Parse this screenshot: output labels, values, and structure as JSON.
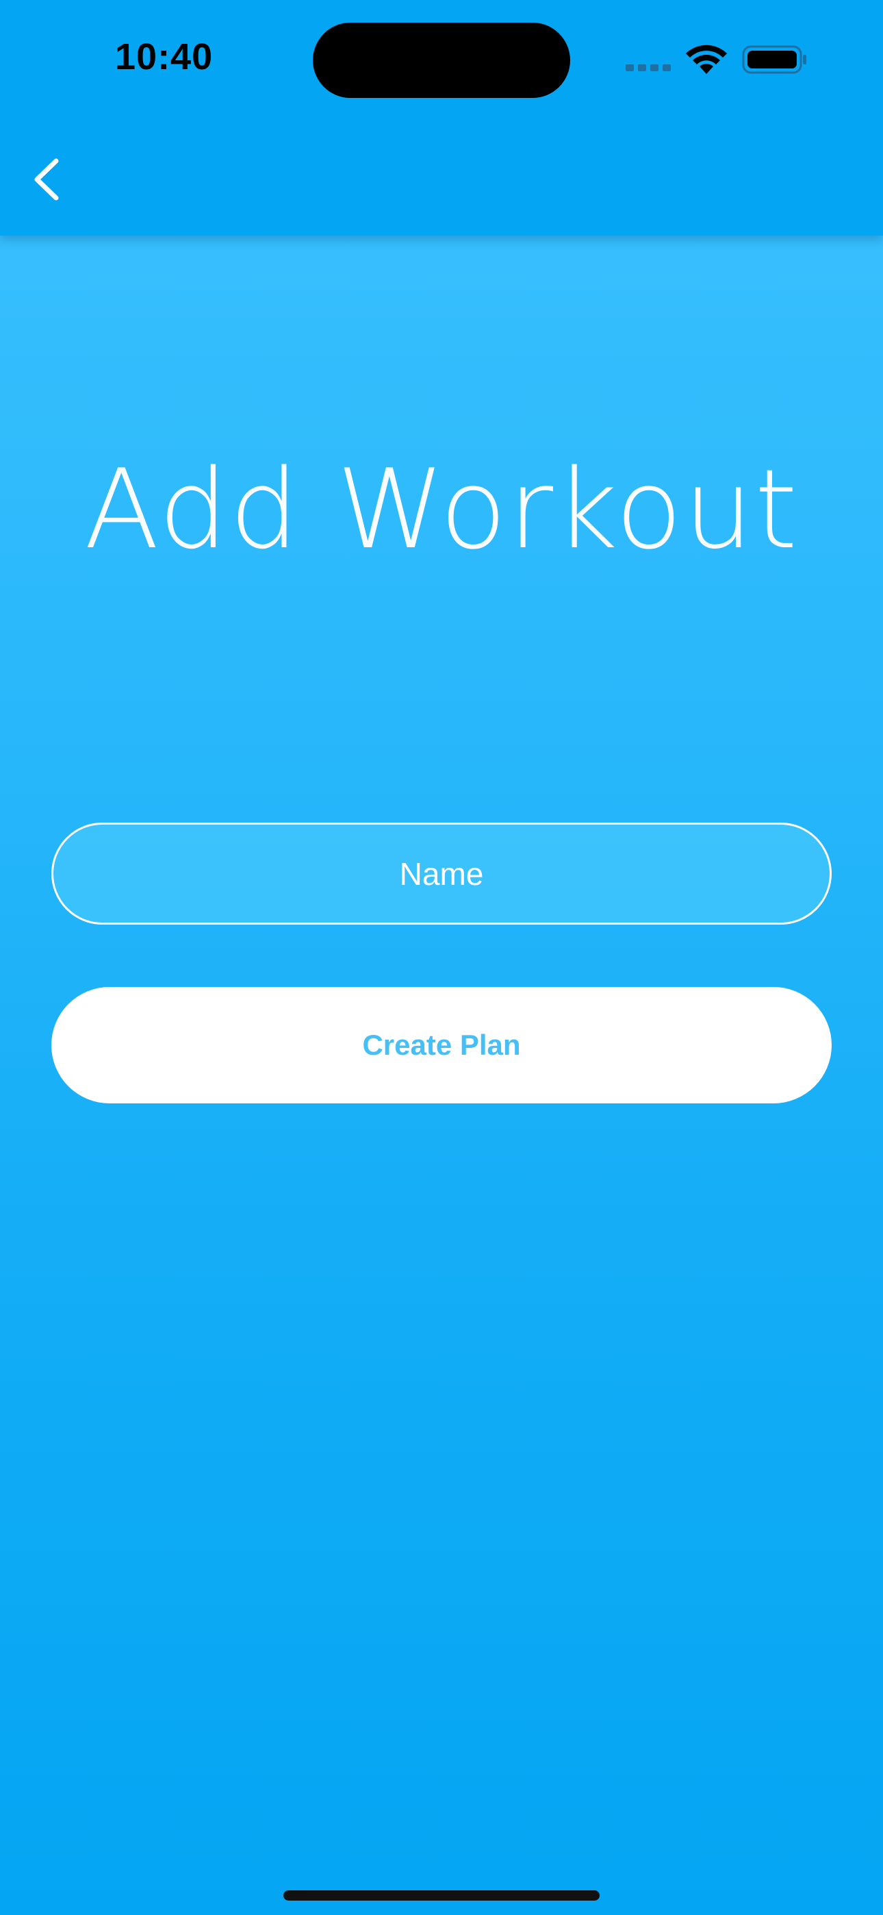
{
  "status_bar": {
    "time": "10:40"
  },
  "nav": {
    "back_icon": "chevron-left-icon"
  },
  "page": {
    "title": "Add Workout"
  },
  "form": {
    "name_placeholder": "Name",
    "name_value": "",
    "submit_label": "Create Plan"
  },
  "colors": {
    "accent": "#04a5f2",
    "gradient_top": "#3ec2ff",
    "gradient_bottom": "#04a5f3",
    "button_text": "#46bff7",
    "white": "#ffffff"
  }
}
